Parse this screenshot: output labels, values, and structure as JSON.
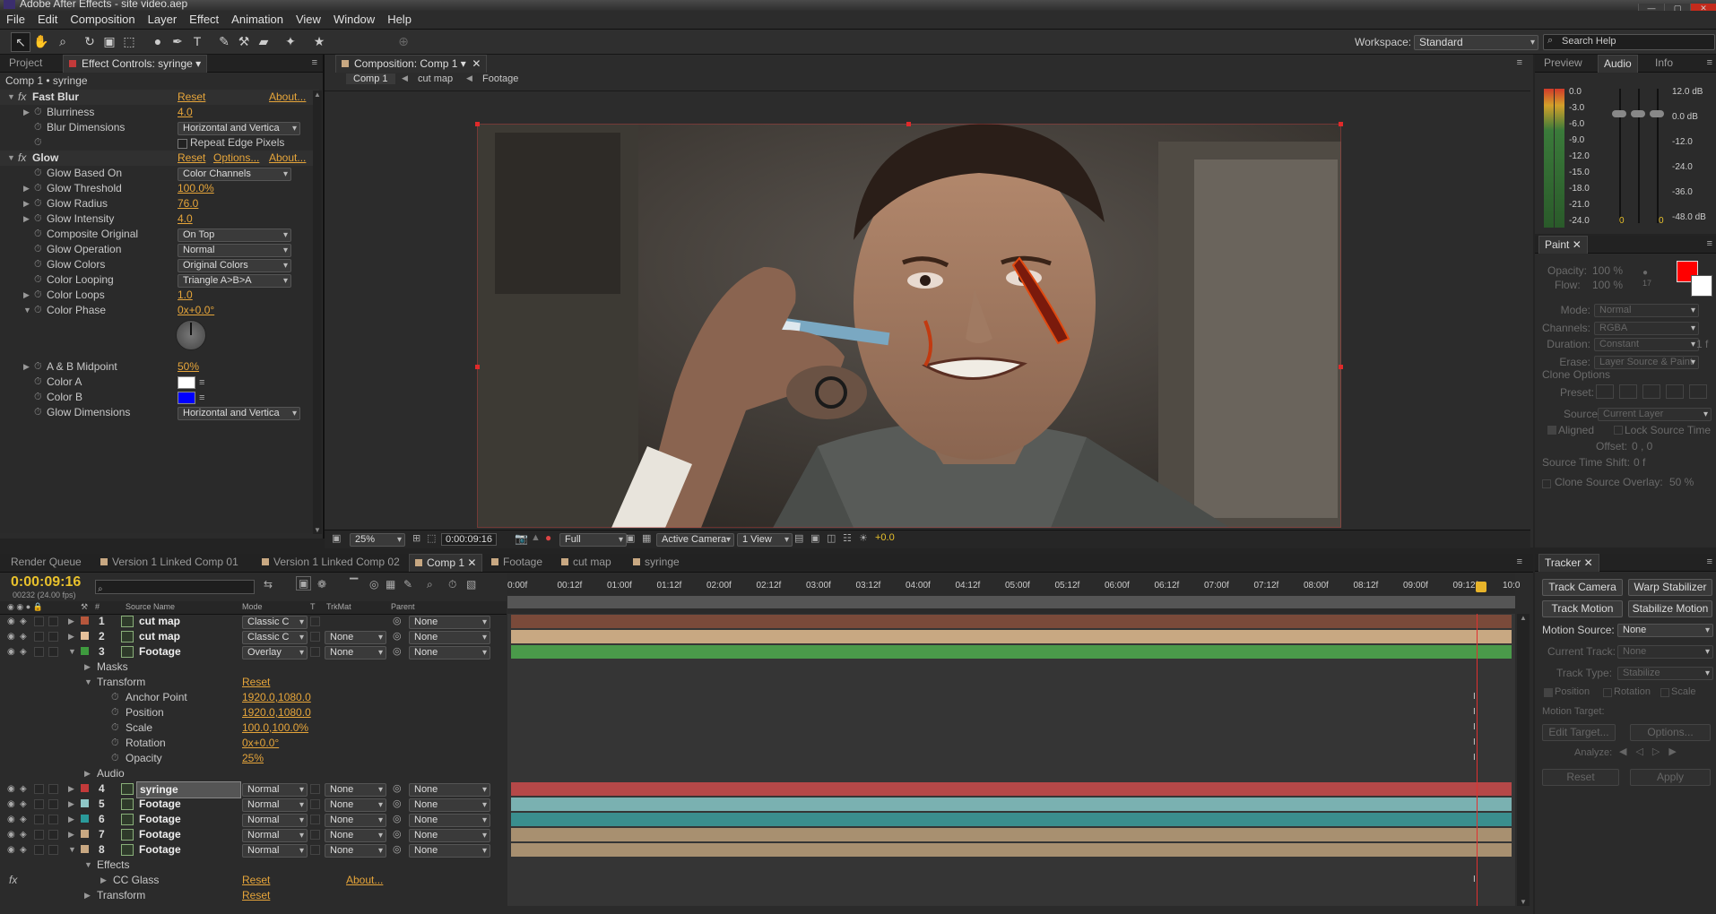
{
  "app": {
    "title": "Adobe After Effects - site video.aep",
    "window_buttons": [
      "—",
      "▢",
      "✕"
    ]
  },
  "menu": [
    "File",
    "Edit",
    "Composition",
    "Layer",
    "Effect",
    "Animation",
    "View",
    "Window",
    "Help"
  ],
  "workspace": {
    "label": "Workspace:",
    "value": "Standard",
    "search_placeholder": "Search Help"
  },
  "left_panel": {
    "tabs": [
      "Project",
      "Effect Controls: syringe"
    ],
    "header": "Comp 1 • syringe",
    "effects": [
      {
        "name": "Fast Blur",
        "reset": "Reset",
        "about": "About...",
        "props": [
          {
            "label": "Blurriness",
            "value": "4.0"
          },
          {
            "label": "Blur Dimensions",
            "dropdown": "Horizontal and Vertica"
          },
          {
            "label": "",
            "checkbox": "Repeat Edge Pixels"
          }
        ]
      },
      {
        "name": "Glow",
        "reset": "Reset",
        "options": "Options...",
        "about": "About...",
        "props": [
          {
            "label": "Glow Based On",
            "dropdown": "Color Channels"
          },
          {
            "label": "Glow Threshold",
            "value": "100.0%"
          },
          {
            "label": "Glow Radius",
            "value": "76.0"
          },
          {
            "label": "Glow Intensity",
            "value": "4.0"
          },
          {
            "label": "Composite Original",
            "dropdown": "On Top"
          },
          {
            "label": "Glow Operation",
            "dropdown": "Normal"
          },
          {
            "label": "Glow Colors",
            "dropdown": "Original Colors"
          },
          {
            "label": "Color Looping",
            "dropdown": "Triangle A>B>A"
          },
          {
            "label": "Color Loops",
            "value": "1.0"
          },
          {
            "label": "Color Phase",
            "value": "0x+0.0°"
          },
          {
            "label": "A & B Midpoint",
            "value": "50%"
          },
          {
            "label": "Color A",
            "swatch": "#ffffff"
          },
          {
            "label": "Color B",
            "swatch": "#0000ff"
          },
          {
            "label": "Glow Dimensions",
            "dropdown": "Horizontal and Vertica"
          }
        ]
      }
    ]
  },
  "comp_panel": {
    "tab": "Composition: Comp 1",
    "breadcrumbs": [
      "Comp 1",
      "cut map",
      "Footage"
    ],
    "zoom": "25%",
    "timecode": "0:00:09:16",
    "resolution": "Full",
    "camera": "Active Camera",
    "view": "1 View",
    "exposure": "+0.0"
  },
  "audio_panel": {
    "tabs": [
      "Preview",
      "Audio",
      "Info"
    ],
    "left_scale": [
      "0.0",
      "-3.0",
      "-6.0",
      "-9.0",
      "-12.0",
      "-15.0",
      "-18.0",
      "-21.0",
      "-24.0"
    ],
    "right_scale": [
      "12.0 dB",
      "0.0 dB",
      "-12.0",
      "-24.0",
      "-36.0",
      "-48.0 dB"
    ],
    "values": [
      "0",
      "0"
    ]
  },
  "paint_panel": {
    "tab": "Paint",
    "opacity": "100 %",
    "flow": "100 %",
    "brush_size": "17",
    "rows": [
      {
        "label": "Opacity:",
        "value": "100 %"
      },
      {
        "label": "Flow:",
        "value": "100 %"
      },
      {
        "label": "Mode:",
        "value": "Normal"
      },
      {
        "label": "Channels:",
        "value": "RGBA"
      },
      {
        "label": "Duration:",
        "value": "Constant"
      },
      {
        "label": "Erase:",
        "value": "Layer Source & Paint"
      }
    ],
    "clone_options": "Clone Options",
    "preset": "Preset:",
    "source_label": "Source:",
    "source": "Current Layer",
    "aligned": "Aligned",
    "lock_source": "Lock Source Time",
    "offset_label": "Offset:",
    "offset": "0 ,        0",
    "shift_label": "Source Time Shift:",
    "shift": "0 f",
    "overlay_label": "Clone Source Overlay:",
    "overlay": "50 %",
    "one_f": "1 f",
    "fg_color": "#ff0000"
  },
  "bottom_tabs": [
    "Render Queue",
    "Version 1 Linked Comp 01",
    "Version 1 Linked Comp 02",
    "Comp 1",
    "Footage",
    "cut map",
    "syringe"
  ],
  "timeline": {
    "timecode": "0:00:09:16",
    "frames": "00232 (24.00 fps)",
    "columns": [
      "#",
      "Source Name",
      "Mode",
      "T",
      "TrkMat",
      "Parent"
    ],
    "ruler": [
      "0:00f",
      "00:12f",
      "01:00f",
      "01:12f",
      "02:00f",
      "02:12f",
      "03:00f",
      "03:12f",
      "04:00f",
      "04:12f",
      "05:00f",
      "05:12f",
      "06:00f",
      "06:12f",
      "07:00f",
      "07:12f",
      "08:00f",
      "08:12f",
      "09:00f",
      "09:12f",
      "10:0"
    ],
    "layers": [
      {
        "num": "1",
        "name": "cut map",
        "mode": "Classic C",
        "trkmat": "",
        "parent": "None",
        "color": "#b7573c",
        "bar": "#7a4a3a"
      },
      {
        "num": "2",
        "name": "cut map",
        "mode": "Classic C",
        "trkmat": "None",
        "parent": "None",
        "color": "#e6c09a",
        "bar": "#c8a882"
      },
      {
        "num": "3",
        "name": "Footage",
        "mode": "Overlay",
        "trkmat": "None",
        "parent": "None",
        "color": "#3e9a3e",
        "bar": "#4a9a4a"
      }
    ],
    "transform": {
      "masks": "Masks",
      "transform": "Transform",
      "reset": "Reset",
      "audio": "Audio",
      "props": [
        {
          "label": "Anchor Point",
          "value": "1920.0,1080.0"
        },
        {
          "label": "Position",
          "value": "1920.0,1080.0"
        },
        {
          "label": "Scale",
          "value": "100.0,100.0%"
        },
        {
          "label": "Rotation",
          "value": "0x+0.0°"
        },
        {
          "label": "Opacity",
          "value": "25%"
        }
      ]
    },
    "layers2": [
      {
        "num": "4",
        "name": "syringe",
        "mode": "Normal",
        "trkmat": "None",
        "parent": "None",
        "color": "#c23a3a",
        "bar": "#b54848"
      },
      {
        "num": "5",
        "name": "Footage",
        "mode": "Normal",
        "trkmat": "None",
        "parent": "None",
        "color": "#8ec7c7",
        "bar": "#7ab1b1"
      },
      {
        "num": "6",
        "name": "Footage",
        "mode": "Normal",
        "trkmat": "None",
        "parent": "None",
        "color": "#2a9a9a",
        "bar": "#3a8e8e"
      },
      {
        "num": "7",
        "name": "Footage",
        "mode": "Normal",
        "trkmat": "None",
        "parent": "None",
        "color": "#c8a882",
        "bar": "#a89070"
      },
      {
        "num": "8",
        "name": "Footage",
        "mode": "Normal",
        "trkmat": "None",
        "parent": "None",
        "color": "#c8a882",
        "bar": "#a89070"
      }
    ],
    "effects_label": "Effects",
    "cc_glass": "CC Glass",
    "cc_reset": "Reset",
    "cc_about": "About...",
    "transform2": "Transform",
    "transform2_reset": "Reset"
  },
  "tracker": {
    "tab": "Tracker",
    "buttons": [
      "Track Camera",
      "Warp Stabilizer",
      "Track Motion",
      "Stabilize Motion"
    ],
    "motion_source_label": "Motion Source:",
    "motion_source": "None",
    "current_track_label": "Current Track:",
    "current_track": "None",
    "track_type_label": "Track Type:",
    "track_type": "Stabilize",
    "checks": [
      "Position",
      "Rotation",
      "Scale"
    ],
    "motion_target": "Motion Target:",
    "edit_target": "Edit Target...",
    "options": "Options...",
    "analyze": "Analyze:",
    "reset": "Reset",
    "apply": "Apply"
  }
}
